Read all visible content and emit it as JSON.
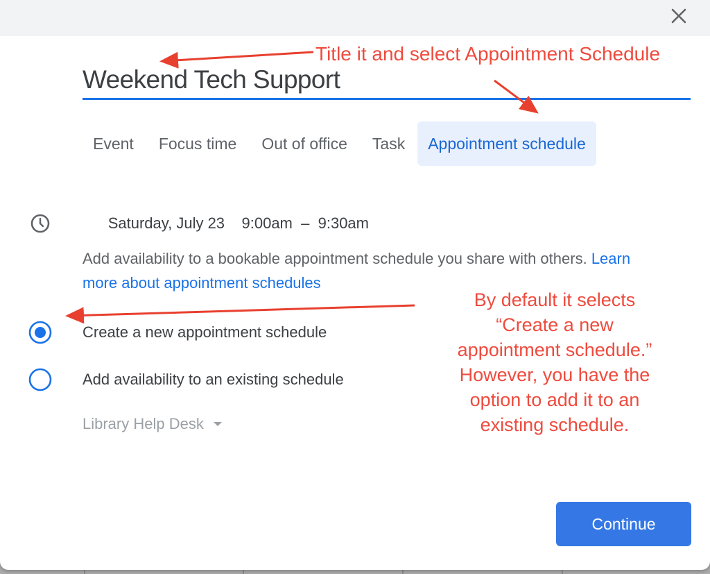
{
  "dialog": {
    "close_icon": "close-icon",
    "title_value": "Weekend Tech Support",
    "tabs": [
      {
        "label": "Event",
        "active": false
      },
      {
        "label": "Focus time",
        "active": false
      },
      {
        "label": "Out of office",
        "active": false
      },
      {
        "label": "Task",
        "active": false
      },
      {
        "label": "Appointment schedule",
        "active": true
      }
    ],
    "time": {
      "icon": "clock-icon",
      "date": "Saturday, July 23",
      "start": "9:00am",
      "separator": "–",
      "end": "9:30am"
    },
    "description": "Add availability to a bookable appointment schedule you share with others.",
    "learn_more_link": "Learn more about appointment schedules",
    "options": [
      {
        "label": "Create a new appointment schedule",
        "selected": true
      },
      {
        "label": "Add availability to an existing schedule",
        "selected": false
      }
    ],
    "schedule_dropdown": {
      "selected": "Library Help Desk"
    },
    "continue_label": "Continue"
  },
  "annotations": {
    "title_note": "Title it and select Appointment Schedule",
    "radio_note": "By default it selects “Create a new appointment schedule.” However, you have the option to add it to an existing schedule."
  },
  "colors": {
    "accent": "#1a73e8",
    "button": "#3578e5",
    "active_tab_bg": "#e8f0fe",
    "annotation": "#ee4b3e"
  }
}
